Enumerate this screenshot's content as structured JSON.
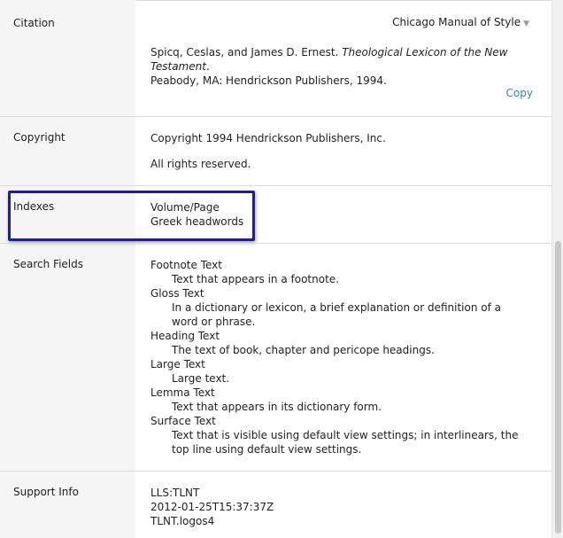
{
  "citation": {
    "label": "Citation",
    "style": "Chicago Manual of Style",
    "author": "Spicq, Ceslas, and James D. Ernest.",
    "title": "Theological Lexicon of the New Testament",
    "publisher": "Peabody, MA: Hendrickson Publishers, 1994.",
    "copy_label": "Copy"
  },
  "copyright": {
    "label": "Copyright",
    "line1": "Copyright 1994 Hendrickson Publishers, Inc.",
    "line2": "All rights reserved."
  },
  "indexes": {
    "label": "Indexes",
    "items": [
      "Volume/Page",
      "Greek headwords"
    ]
  },
  "search_fields": {
    "label": "Search Fields",
    "items": [
      {
        "name": "Footnote Text",
        "desc": "Text that appears in a footnote."
      },
      {
        "name": "Gloss Text",
        "desc": "In a dictionary or lexicon, a brief explanation or definition of a word or phrase."
      },
      {
        "name": "Heading Text",
        "desc": "The text of book, chapter and pericope headings."
      },
      {
        "name": "Large Text",
        "desc": "Large text."
      },
      {
        "name": "Lemma Text",
        "desc": "Text that appears in its dictionary form."
      },
      {
        "name": "Surface Text",
        "desc": "Text that is visible using default view settings; in interlinears, the top line using default view settings."
      }
    ]
  },
  "support": {
    "label": "Support Info",
    "lines": [
      "LLS:TLNT",
      "2012-01-25T15:37:37Z",
      "TLNT.logos4"
    ]
  },
  "colors": {
    "highlight": "#1a1ab8",
    "link": "#3f7fb8"
  }
}
